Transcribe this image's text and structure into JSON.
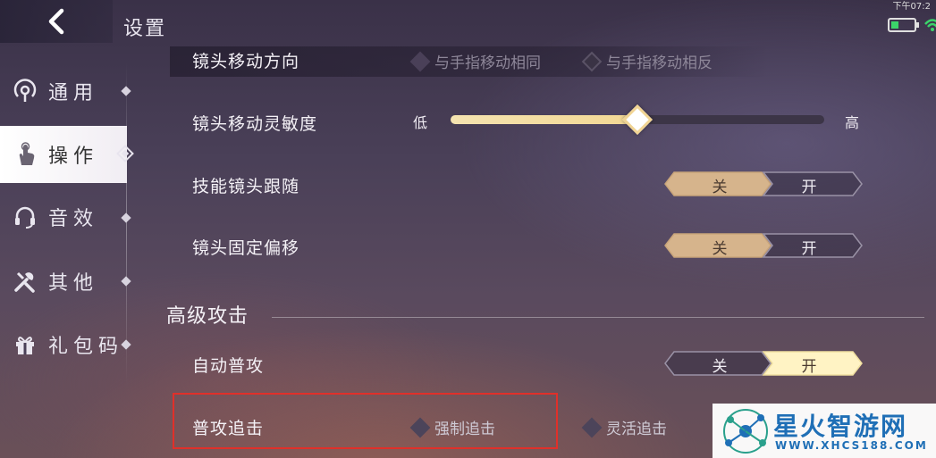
{
  "header": {
    "title": "设置",
    "status_time": "下午07:2"
  },
  "sidebar": {
    "items": [
      {
        "label": "通用",
        "icon": "radio-signal-icon"
      },
      {
        "label": "操作",
        "icon": "touch-hand-icon",
        "active": true
      },
      {
        "label": "音效",
        "icon": "headset-icon"
      },
      {
        "label": "其他",
        "icon": "tools-icon"
      },
      {
        "label": "礼包码",
        "icon": "gift-icon"
      }
    ]
  },
  "settings": {
    "camera_direction": {
      "label": "镜头移动方向",
      "options": [
        "与手指移动相同",
        "与手指移动相反"
      ]
    },
    "camera_sensitivity": {
      "label": "镜头移动灵敏度",
      "low": "低",
      "high": "高",
      "value_fraction": 0.5
    },
    "skill_camera_follow": {
      "label": "技能镜头跟随",
      "off": "关",
      "on": "开",
      "state": "off"
    },
    "camera_fixed_offset": {
      "label": "镜头固定偏移",
      "off": "关",
      "on": "开",
      "state": "off"
    }
  },
  "advanced": {
    "section_title": "高级攻击",
    "auto_attack": {
      "label": "自动普攻",
      "off": "关",
      "on": "开",
      "state": "on"
    },
    "attack_chase": {
      "label": "普攻追击",
      "options": [
        "强制追击",
        "灵活追击"
      ]
    }
  },
  "watermark": {
    "title": "星火智游网",
    "url": "WWW.XHCS188.COM"
  },
  "colors": {
    "toggle_active": "#d6b48c",
    "toggle_on_active": "#fff3c4",
    "slider_fill": "#f3d894",
    "highlight": "#e0302a"
  }
}
